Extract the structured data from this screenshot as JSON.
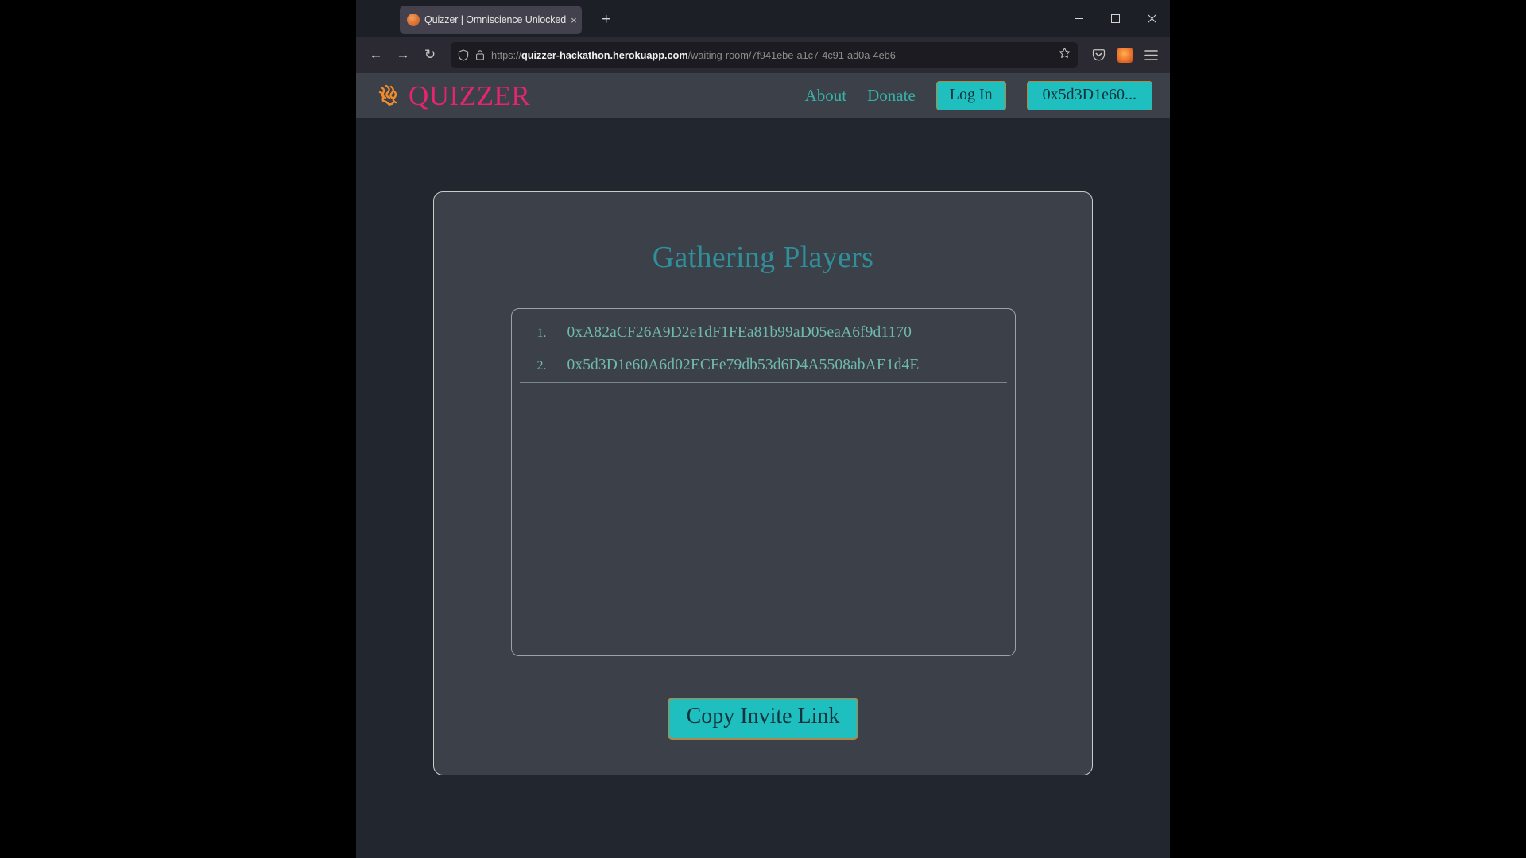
{
  "browser": {
    "tab": {
      "title": "Quizzer | Omniscience Unlocked",
      "close_label": "×",
      "favicon_name": "quizzer-favicon"
    },
    "new_tab_label": "+",
    "window_controls": {
      "minimize": "minimize",
      "maximize": "maximize",
      "close": "close"
    },
    "nav": {
      "back_label": "←",
      "forward_label": "→",
      "reload_label": "↻"
    },
    "url": {
      "scheme": "https://",
      "host": "quizzer-hackathon.herokuapp.com",
      "path": "/waiting-room/7f941ebe-a1c7-4c91-ad0a-4eb6",
      "full": "https://quizzer-hackathon.herokuapp.com/waiting-room/7f941ebe-a1c7-4c91-ad0a-4eb6"
    },
    "toolbar": {
      "pocket": "save-to-pocket",
      "account": "firefox-account",
      "menu": "application-menu"
    }
  },
  "site": {
    "brand": "QUIZZER",
    "brand_color": "#e8246e",
    "accent_color": "#1fbfbf",
    "nav_links": [
      {
        "label": "About"
      },
      {
        "label": "Donate"
      }
    ],
    "buttons": {
      "login": "Log In",
      "wallet": "0x5d3D1e60..."
    }
  },
  "main": {
    "title": "Gathering Players",
    "players": [
      {
        "index": "1.",
        "address": "0xA82aCF26A9D2e1dF1FEa81b99aD05eaA6f9d1170"
      },
      {
        "index": "2.",
        "address": "0x5d3D1e60A6d02ECFe79db53d6D4A5508abAE1d4E"
      }
    ],
    "copy_button": "Copy Invite Link"
  }
}
